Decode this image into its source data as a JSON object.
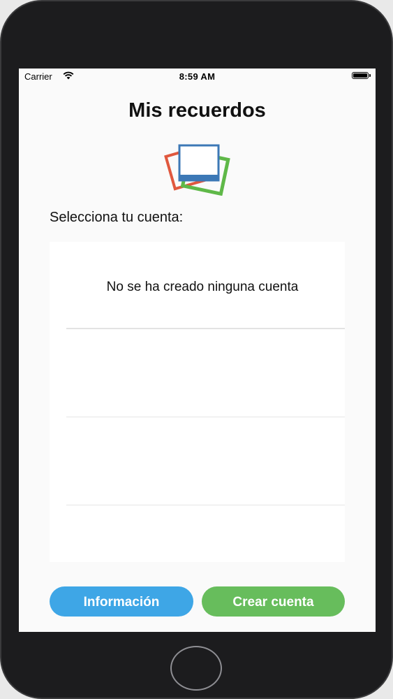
{
  "status_bar": {
    "carrier": "Carrier",
    "time": "8:59 AM",
    "wifi_icon": "wifi-icon",
    "battery_icon": "battery-icon"
  },
  "header": {
    "title": "Mis recuerdos",
    "logo_icon": "photos-stack-icon"
  },
  "accounts": {
    "label": "Selecciona tu cuenta:",
    "empty_message": "No se ha creado ninguna cuenta"
  },
  "footer": {
    "info_button": "Información",
    "create_button": "Crear cuenta"
  },
  "colors": {
    "info_button": "#3ea6e6",
    "create_button": "#67bd5c",
    "logo_blue": "#3c78b6",
    "logo_red": "#e0583e",
    "logo_green": "#5fb848"
  }
}
